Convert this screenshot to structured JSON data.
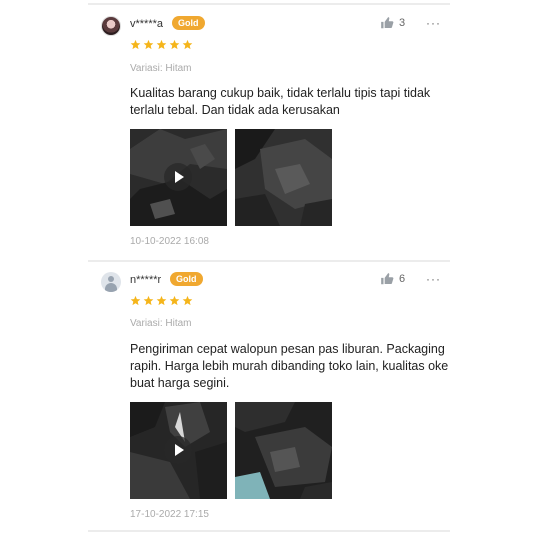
{
  "reviews": [
    {
      "username": "v*****a",
      "badge": "Gold",
      "like_count": "3",
      "more": "···",
      "rating": 5,
      "variant": "Variasi: Hitam",
      "text": "Kualitas barang cukup baik, tidak terlalu tipis tapi tidak terlalu tebal. Dan tidak ada kerusakan",
      "media": [
        {
          "kind": "video",
          "description": "black plastic raincoat"
        },
        {
          "kind": "image",
          "description": "black plastic raincoat"
        }
      ],
      "date": "10-10-2022 16:08"
    },
    {
      "username": "n*****r",
      "badge": "Gold",
      "like_count": "6",
      "more": "···",
      "rating": 5,
      "variant": "Variasi: Hitam",
      "text": "Pengiriman cepat walopun pesan pas liburan. Packaging rapih. Harga lebih murah dibanding toko lain, kualitas oke buat harga segini.",
      "media": [
        {
          "kind": "video",
          "description": "black plastic raincoat"
        },
        {
          "kind": "image",
          "description": "black plastic raincoat"
        }
      ],
      "date": "17-10-2022 17:15"
    }
  ],
  "colors": {
    "star": "#f5b51b",
    "badge": "#f0a830",
    "muted_text": "#aaaaaa"
  }
}
